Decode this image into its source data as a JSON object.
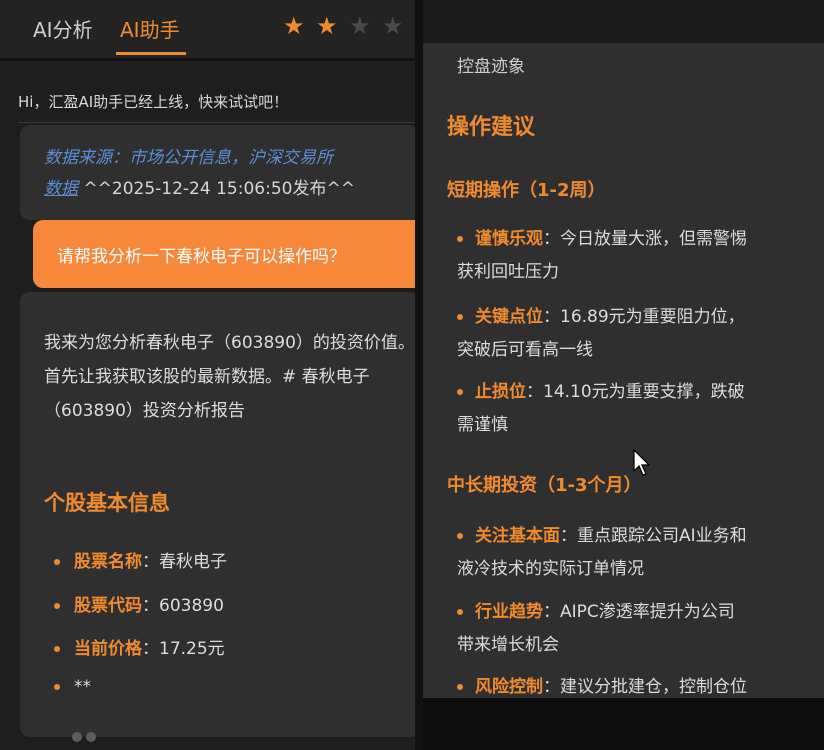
{
  "tabs": {
    "analysis": "AI分析",
    "assistant": "AI助手"
  },
  "rating": {
    "filled": 2,
    "total": 4
  },
  "welcome": "Hi，汇盈AI助手已经上线，快来试试吧！",
  "prev_message": {
    "source_line": "数据来源：市场公开信息，沪深交易所",
    "source_link": "数据",
    "timestamp": "^^2025-12-24 15:06:50发布^^"
  },
  "user_message": "请帮我分析一下春秋电子可以操作吗？",
  "ai_message": {
    "intro": "我来为您分析春秋电子（603890）的投资价值。首先让我获取该股的最新数据。# 春秋电子（603890）投资分析报告",
    "heading": "个股基本信息",
    "items": [
      {
        "label": "股票名称",
        "value": "：春秋电子"
      },
      {
        "label": "股票代码",
        "value": "：603890"
      },
      {
        "label": "当前价格",
        "value": "：17.25元"
      },
      {
        "label": "",
        "value": "**"
      }
    ]
  },
  "right_panel": {
    "top_text": "控盘迹象",
    "heading": "操作建议",
    "short_term": {
      "title": "短期操作（1-2周）",
      "items": [
        {
          "label": "谨慎乐观",
          "line1": "：今日放量大涨，但需警惕",
          "line2": "获利回吐压力"
        },
        {
          "label": "关键点位",
          "line1": "：16.89元为重要阻力位，",
          "line2": "突破后可看高一线"
        },
        {
          "label": "止损位",
          "line1": "：14.10元为重要支撑，跌破",
          "line2": "需谨慎"
        }
      ]
    },
    "long_term": {
      "title": "中长期投资（1-3个月）",
      "items": [
        {
          "label": "关注基本面",
          "line1": "：重点跟踪公司AI业务和",
          "line2": "液冷技术的实际订单情况"
        },
        {
          "label": "行业趋势",
          "line1": "：AIPC渗透率提升为公司",
          "line2": "带来增长机会"
        },
        {
          "label": "风险控制",
          "line1": "：建议分批建仓，控制仓位",
          "line2": ""
        }
      ]
    }
  },
  "colors": {
    "accent": "#f08a2e",
    "panel": "#2f2f30",
    "link": "#5a8fd8"
  }
}
